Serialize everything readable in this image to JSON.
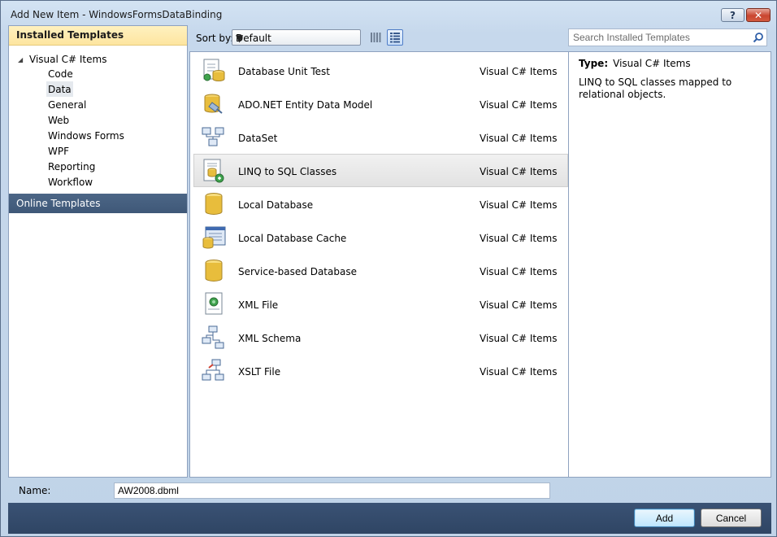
{
  "window": {
    "title": "Add New Item - WindowsFormsDataBinding",
    "help_glyph": "?",
    "close_glyph": "✕"
  },
  "left": {
    "installed_header": "Installed Templates",
    "root_label": "Visual C# Items",
    "items": [
      {
        "label": "Code"
      },
      {
        "label": "Data"
      },
      {
        "label": "General"
      },
      {
        "label": "Web"
      },
      {
        "label": "Windows Forms"
      },
      {
        "label": "WPF"
      },
      {
        "label": "Reporting"
      },
      {
        "label": "Workflow"
      }
    ],
    "selected_item": "Data",
    "online_header": "Online Templates"
  },
  "toolbar": {
    "sort_label": "Sort by:",
    "sort_value": "Default",
    "search_placeholder": "Search Installed Templates"
  },
  "templates": [
    {
      "name": "Database Unit Test",
      "type": "Visual C# Items",
      "icon": "database-unit-test-icon"
    },
    {
      "name": "ADO.NET Entity Data Model",
      "type": "Visual C# Items",
      "icon": "entity-data-model-icon"
    },
    {
      "name": "DataSet",
      "type": "Visual C# Items",
      "icon": "dataset-icon"
    },
    {
      "name": "LINQ to SQL Classes",
      "type": "Visual C# Items",
      "icon": "linq-to-sql-icon"
    },
    {
      "name": "Local Database",
      "type": "Visual C# Items",
      "icon": "database-cylinder-icon"
    },
    {
      "name": "Local Database Cache",
      "type": "Visual C# Items",
      "icon": "database-cache-icon"
    },
    {
      "name": "Service-based Database",
      "type": "Visual C# Items",
      "icon": "database-cylinder-icon"
    },
    {
      "name": "XML File",
      "type": "Visual C# Items",
      "icon": "xml-file-icon"
    },
    {
      "name": "XML Schema",
      "type": "Visual C# Items",
      "icon": "xml-schema-icon"
    },
    {
      "name": "XSLT File",
      "type": "Visual C# Items",
      "icon": "xslt-file-icon"
    }
  ],
  "selected_template": "LINQ to SQL Classes",
  "details": {
    "type_label": "Type:",
    "type_value": "Visual C# Items",
    "description": "LINQ to SQL classes mapped to relational objects."
  },
  "bottom": {
    "name_label": "Name:",
    "name_value": "AW2008.dbml",
    "add_label": "Add",
    "cancel_label": "Cancel"
  }
}
